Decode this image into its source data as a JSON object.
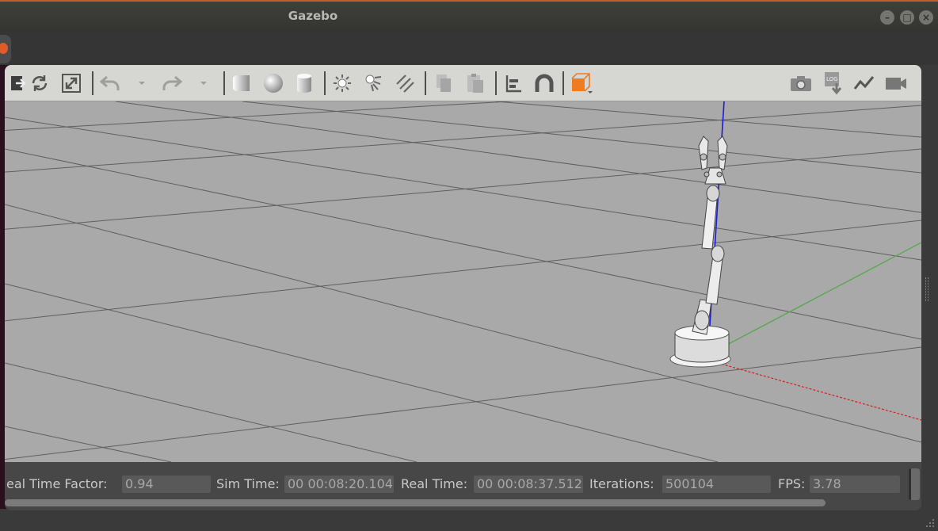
{
  "window": {
    "title": "Gazebo"
  },
  "toolbar": {
    "tools": [
      {
        "name": "translate-tool",
        "icon": "arrow-right-icon"
      },
      {
        "name": "rotate-tool",
        "icon": "rotate-icon"
      },
      {
        "name": "scale-tool",
        "icon": "scale-icon"
      },
      {
        "name": "undo-button",
        "icon": "undo-icon"
      },
      {
        "name": "undo-history-dropdown",
        "icon": "chevron-down-icon"
      },
      {
        "name": "redo-button",
        "icon": "redo-icon"
      },
      {
        "name": "redo-history-dropdown",
        "icon": "chevron-down-icon"
      },
      {
        "name": "box-shape-button",
        "icon": "box-icon"
      },
      {
        "name": "sphere-shape-button",
        "icon": "sphere-icon"
      },
      {
        "name": "cylinder-shape-button",
        "icon": "cylinder-icon"
      },
      {
        "name": "point-light-button",
        "icon": "sun-icon"
      },
      {
        "name": "spot-light-button",
        "icon": "spotlight-icon"
      },
      {
        "name": "directional-light-button",
        "icon": "directional-light-icon"
      },
      {
        "name": "copy-button",
        "icon": "copy-icon"
      },
      {
        "name": "paste-button",
        "icon": "paste-icon"
      },
      {
        "name": "align-button",
        "icon": "align-icon"
      },
      {
        "name": "snap-button",
        "icon": "magnet-icon"
      },
      {
        "name": "view-angle-button",
        "icon": "orange-box-icon"
      },
      {
        "name": "screenshot-button",
        "icon": "camera-icon"
      },
      {
        "name": "log-button",
        "icon": "log-icon"
      },
      {
        "name": "plot-button",
        "icon": "plot-icon"
      },
      {
        "name": "record-video-button",
        "icon": "video-camera-icon"
      }
    ]
  },
  "status": {
    "rtf_label": "eal Time Factor:",
    "rtf_value": "0.94",
    "sim_time_label": "Sim Time:",
    "sim_time_value": "00 00:08:20.104",
    "real_time_label": "Real Time:",
    "real_time_value": "00 00:08:37.512",
    "iterations_label": "Iterations:",
    "iterations_value": "500104",
    "fps_label": "FPS:",
    "fps_value": "3.78"
  },
  "colors": {
    "accent": "#d6703a",
    "x_axis": "#d42020",
    "y_axis": "#59a84f",
    "z_axis": "#1b1bd8",
    "ground": "#a9a9a9",
    "grid": "#5a5a5a"
  }
}
